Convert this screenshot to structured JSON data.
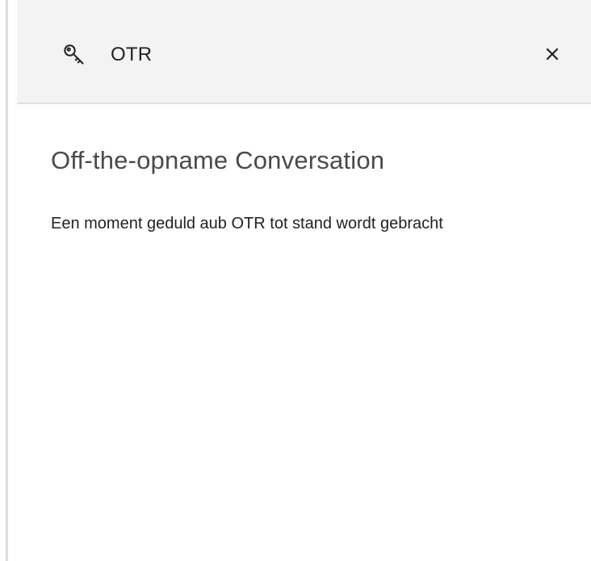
{
  "header": {
    "title": "OTR",
    "icons": {
      "key": "key-icon",
      "close": "close-icon"
    }
  },
  "content": {
    "title": "Off-the-opname Conversation",
    "message": "Een moment geduld aub OTR tot stand wordt gebracht"
  },
  "colors": {
    "header_background": "#f3f3f3",
    "panel_background": "#ffffff",
    "text_primary": "#222222",
    "text_heading": "#4a4a4a",
    "divider": "#e1e1e1"
  }
}
